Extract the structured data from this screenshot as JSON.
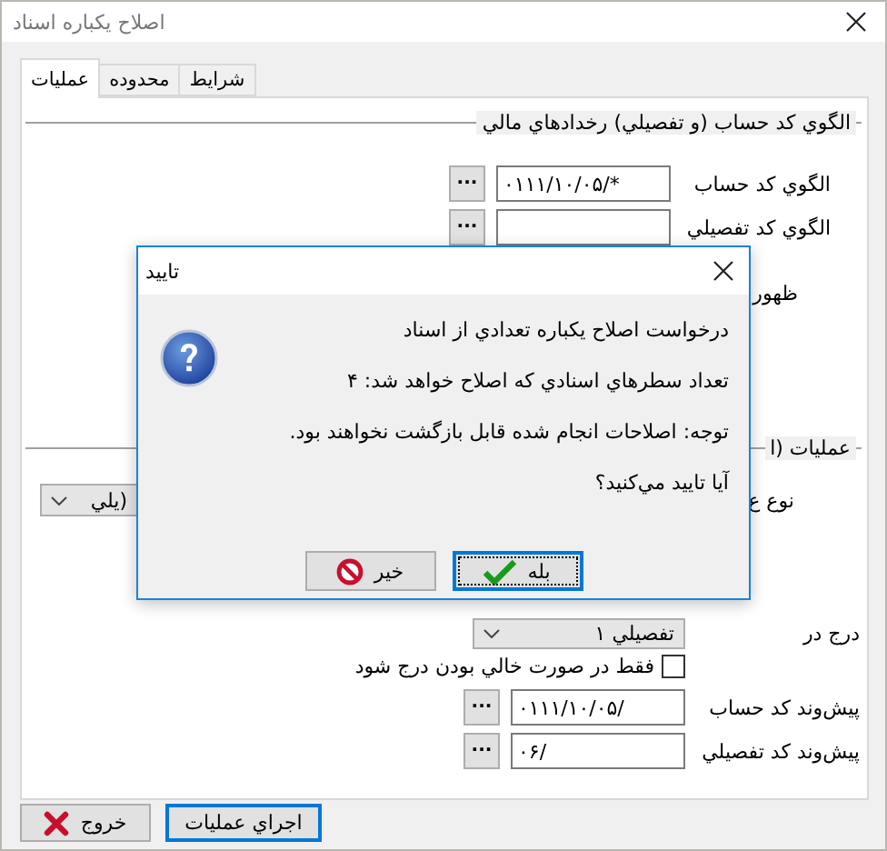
{
  "window": {
    "title": "اصلاح يكباره اسناد"
  },
  "tabs": [
    {
      "label": "شرايط",
      "selected": false
    },
    {
      "label": "محدوده",
      "selected": false
    },
    {
      "label": "عمليات",
      "selected": true
    }
  ],
  "groups": [
    {
      "legend": "الگوي كد حساب (و تفصيلي) رخدادهاي مالي",
      "rows": [
        {
          "kind": "field",
          "label": "الگوي كد حساب",
          "value": "۰۱۱۱/۱۰/۰۵/*",
          "browse": "..."
        },
        {
          "kind": "field",
          "label": "الگوي كد تفصيلي",
          "browse": "..."
        },
        {
          "kind": "cut-label",
          "label": "ظهور"
        }
      ]
    },
    {
      "legend": "عمليات (ا",
      "rows": [
        {
          "kind": "cut-combo",
          "label": "نوع ع",
          "value": "(يلي"
        },
        {
          "kind": "combo",
          "label": "درج در",
          "value": "تفصيلي ۱"
        },
        {
          "kind": "checkbox",
          "label": "فقط در صورت خالي بودن درج شود",
          "checked": false
        },
        {
          "kind": "field",
          "label": "پيش‌وند كد حساب",
          "value": "۰۱۱۱/۱۰/۰۵/",
          "browse": "..."
        },
        {
          "kind": "field",
          "label": "پيش‌وند كد تفصيلي",
          "value": "۰۶/",
          "browse": "..."
        }
      ]
    }
  ],
  "buttons": [
    {
      "label": "اجراي عمليات",
      "kind": "run",
      "focused": true
    },
    {
      "label": "خروج",
      "kind": "exit",
      "focused": false
    }
  ],
  "dialog": {
    "title": "تاييد",
    "lines": [
      "درخواست اصلاح يكباره تعدادي از اسناد",
      "تعداد سطرهاي اسنادي كه اصلاح خواهد شد: ۴",
      "توجه: اصلاحات انجام شده قابل بازگشت نخواهند بود.",
      "آيا تاييد مي‌كنيد؟"
    ],
    "buttons": [
      {
        "label": "بله",
        "kind": "yes",
        "focused": true
      },
      {
        "label": "خير",
        "kind": "no",
        "focused": false
      }
    ]
  }
}
